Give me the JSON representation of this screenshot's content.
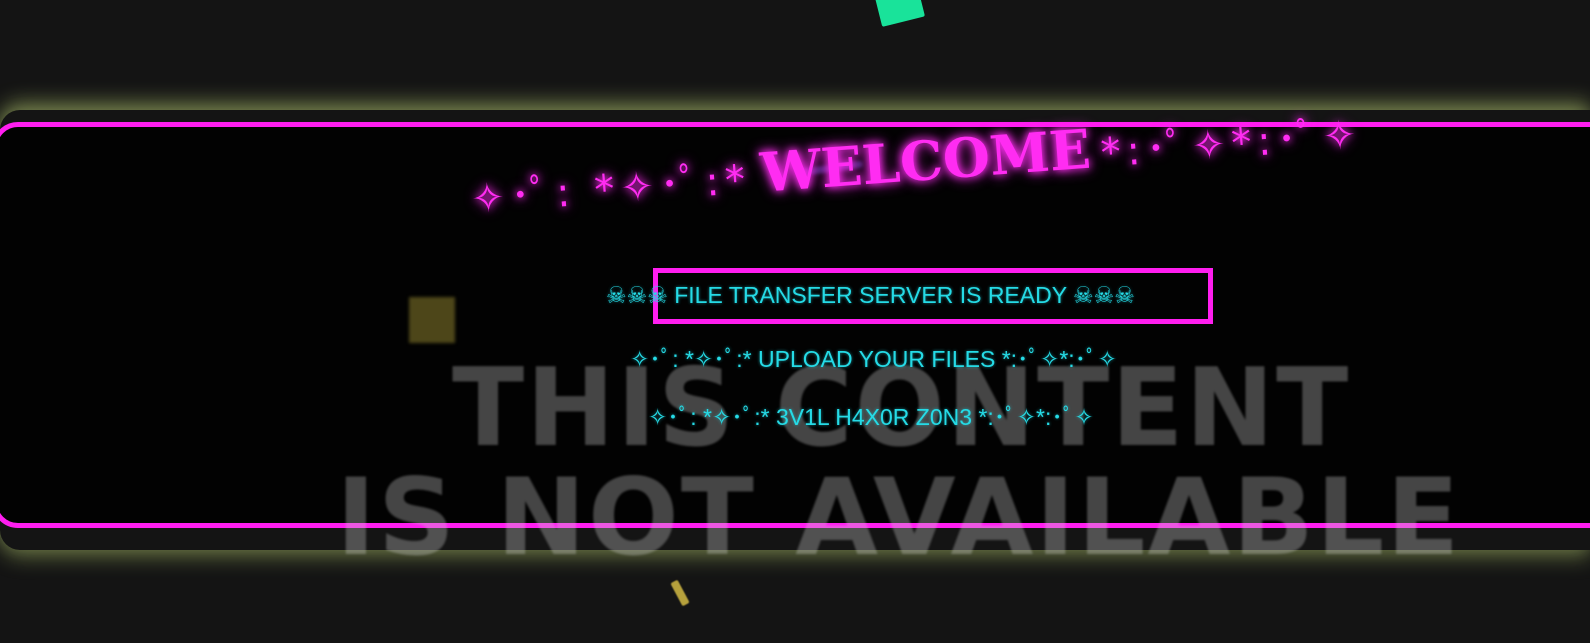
{
  "welcome": {
    "prefix": "✧･ﾟ: *✧･ﾟ:*",
    "word": "WELCOME",
    "suffix": "*:･ﾟ✧*:･ﾟ✧"
  },
  "status_line": "☠☠☠ FILE TRANSFER SERVER IS READY ☠☠☠",
  "upload_line": "✧･ﾟ: *✧･ﾟ:* UPLOAD YOUR FILES *:･ﾟ✧*:･ﾟ✧",
  "zone_line": "✧･ﾟ: *✧･ﾟ:* 3V1L H4X0R Z0N3 *:･ﾟ✧*:･ﾟ✧",
  "unavailable_overlay": {
    "line1": "THIS CONTENT",
    "line2": "IS NOT AVAILABLE"
  },
  "colors": {
    "accent_magenta": "#ff1ef0",
    "text_cyan": "#25dbe6",
    "background": "#020202"
  }
}
